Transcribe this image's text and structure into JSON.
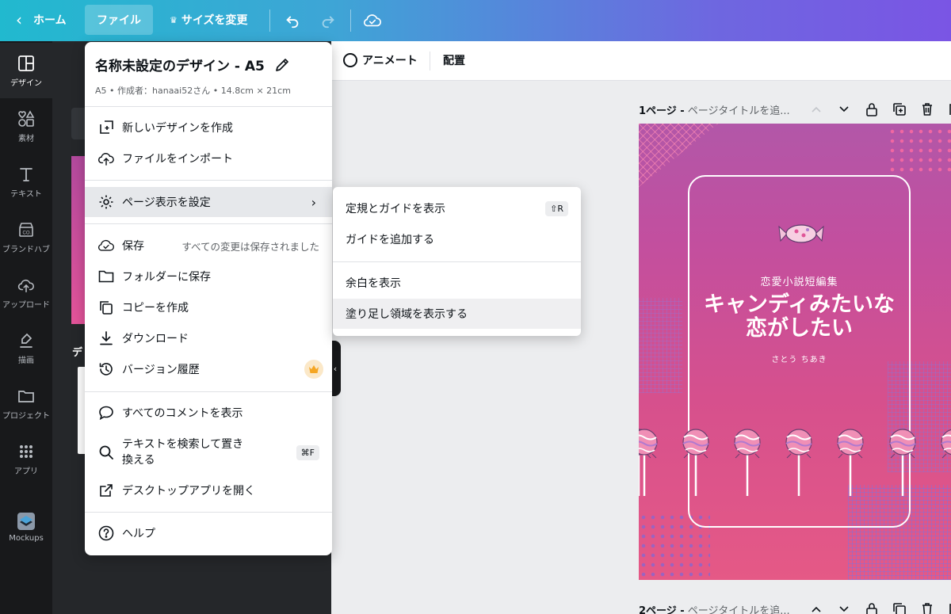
{
  "topbar": {
    "home_label": "ホーム",
    "file_label": "ファイル",
    "resize_label": "サイズを変更"
  },
  "rail": {
    "items": [
      {
        "label": "デザイン",
        "icon": "layout-icon"
      },
      {
        "label": "素材",
        "icon": "shapes-icon"
      },
      {
        "label": "テキスト",
        "icon": "text-icon"
      },
      {
        "label": "ブランドハブ",
        "icon": "brand-icon"
      },
      {
        "label": "アップロード",
        "icon": "upload-icon"
      },
      {
        "label": "描画",
        "icon": "draw-icon"
      },
      {
        "label": "プロジェクト",
        "icon": "folder-icon"
      },
      {
        "label": "アプリ",
        "icon": "apps-icon"
      },
      {
        "label": "Mockups",
        "icon": "mockups-icon"
      }
    ]
  },
  "panel": {
    "section_label": "デ"
  },
  "toolbar2": {
    "animate_label": "アニメート",
    "arrange_label": "配置"
  },
  "pages": [
    {
      "number": "1ページ -",
      "title": "ページタイトルを追..."
    },
    {
      "number": "2ページ -",
      "title": "ページタイトルを追..."
    }
  ],
  "design": {
    "subtitle": "恋愛小説短編集",
    "title_line1": "キャンディみたいな",
    "title_line2": "恋がしたい",
    "author": "さとう ちあき"
  },
  "menu": {
    "title": "名称未設定のデザイン - A5",
    "meta": "A5 • 作成者：hanaai52さん • 14.8cm × 21cm",
    "items": {
      "new_design": "新しいデザインを作成",
      "import_file": "ファイルをインポート",
      "view_settings": "ページ表示を設定",
      "save": "保存",
      "save_status": "すべての変更は保存されました",
      "save_folder": "フォルダーに保存",
      "make_copy": "コピーを作成",
      "download": "ダウンロード",
      "version_history": "バージョン履歴",
      "show_comments": "すべてのコメントを表示",
      "find_replace_1": "テキストを検索して置き",
      "find_replace_2": "換える",
      "find_replace_kbd": "⌘F",
      "desktop_app": "デスクトップアプリを開く",
      "help": "ヘルプ"
    }
  },
  "submenu": {
    "rulers": "定規とガイドを表示",
    "rulers_kbd": "⇧R",
    "add_guide": "ガイドを追加する",
    "margins": "余白を表示",
    "bleed": "塗り足し領域を表示する"
  },
  "colors": {
    "topbar_start": "#21b9cf",
    "topbar_end": "#7a55e4",
    "rail_bg": "#18191b",
    "design_top": "#b257a8",
    "design_bottom": "#e55986",
    "crown": "#f5a623"
  }
}
